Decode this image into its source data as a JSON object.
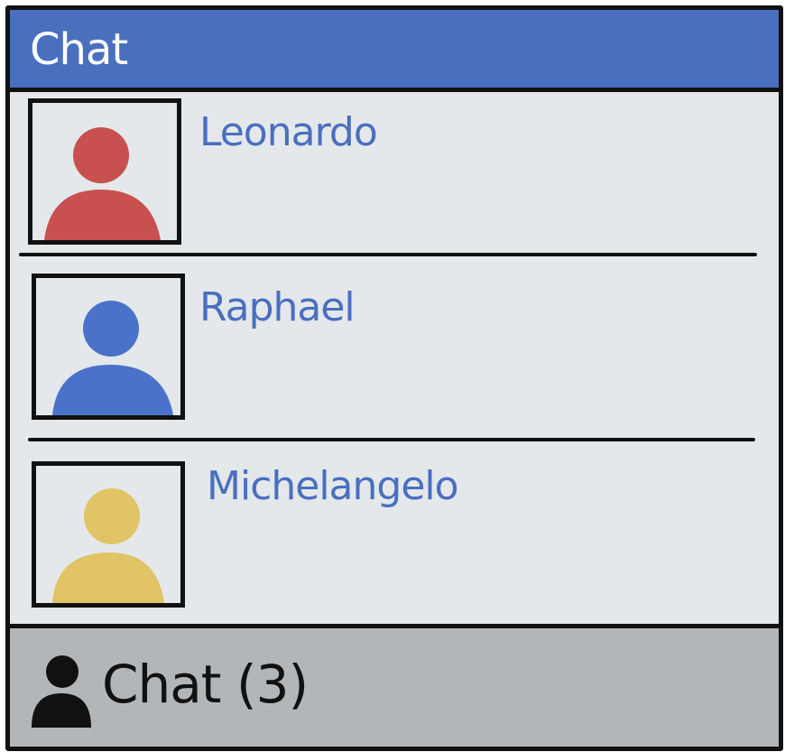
{
  "window": {
    "title": "Chat"
  },
  "contacts": [
    {
      "name": "Leonardo",
      "avatar_icon": "user-avatar-icon",
      "color": "#c8504f"
    },
    {
      "name": "Raphael",
      "avatar_icon": "user-avatar-icon",
      "color": "#4a72c9"
    },
    {
      "name": "Michelangelo",
      "avatar_icon": "user-avatar-icon",
      "color": "#e0c465"
    }
  ],
  "footer": {
    "icon": "person-icon",
    "label": "Chat (3)"
  },
  "colors": {
    "titlebar": "#4a6fbf",
    "name_text": "#4a6fbf",
    "list_background": "#e4e8eb",
    "footer_background": "#b3b6b9"
  }
}
